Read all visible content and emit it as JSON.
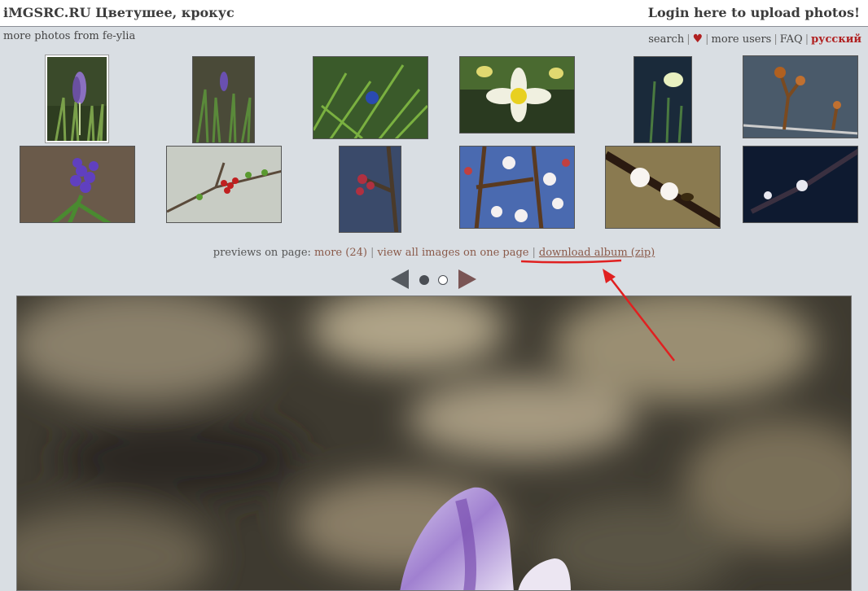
{
  "header": {
    "site_title": "iMGSRC.RU Цветушее, крокус",
    "login_text": "Login here to upload photos!"
  },
  "subheader": {
    "more_from": "more photos from fe-ylia",
    "nav": {
      "search": "search",
      "heart_icon": "heart-icon",
      "more_users": "more users",
      "faq": "FAQ",
      "language": "русский"
    }
  },
  "thumbnails": [
    {
      "label": "crocus"
    },
    {
      "label": "crocus grass"
    },
    {
      "label": "blue flower grass"
    },
    {
      "label": "yellow daffodil"
    },
    {
      "label": "white snowdrop"
    },
    {
      "label": "buds branch"
    },
    {
      "label": "hyacinth"
    },
    {
      "label": "red berries branch"
    },
    {
      "label": "apricot buds"
    },
    {
      "label": "apricot blossom"
    },
    {
      "label": "blossom with bee"
    },
    {
      "label": "white blossom dark"
    }
  ],
  "previews": {
    "label": "previews on page:",
    "more_label": "more",
    "more_count": "(24)",
    "view_all": "view all images on one page",
    "download": "download album (zip)"
  },
  "pager": {
    "prev_icon": "arrow-left-icon",
    "next_icon": "arrow-right-icon",
    "pages": 2,
    "current": 1
  },
  "annotation": {
    "color": "#e02020"
  }
}
